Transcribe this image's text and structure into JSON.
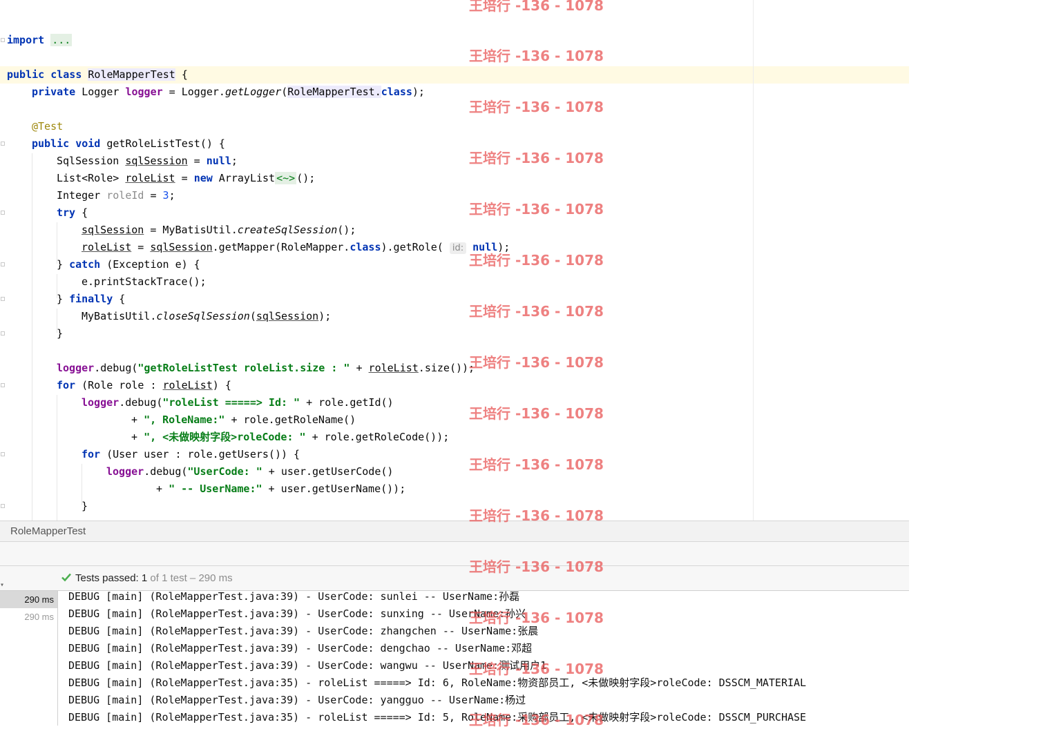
{
  "editor": {
    "lines": {
      "import_kw": "import",
      "import_fold": "...",
      "class_decl": {
        "kw": "public class",
        "name": "RoleMapperTest",
        "brace": " {"
      },
      "logger_decl": {
        "kw": "private",
        "type": " Logger ",
        "field": "logger",
        "eq": " = Logger.",
        "method": "getLogger",
        "open": "(",
        "ref": "RoleMapperTest",
        "dot": ".",
        "cls": "class",
        "close": ");"
      },
      "annotation": "@Test",
      "method_decl": {
        "kw": "public void",
        "rest": " getRoleListTest() {"
      },
      "l1": {
        "type": "SqlSession ",
        "var": "sqlSession",
        "eq": " = ",
        "nul": "null",
        "semi": ";"
      },
      "l2": {
        "type": "List<Role> ",
        "var": "roleList",
        "eq": " = ",
        "kw": "new",
        "cls": " ArrayList",
        "diamond": "<~>",
        "end": "();"
      },
      "l3": {
        "type": "Integer ",
        "var": "roleId",
        "eq": " = ",
        "num": "3",
        "semi": ";"
      },
      "l4": {
        "kw": "try",
        "brace": " {"
      },
      "l5": {
        "var": "sqlSession",
        "eq": " = MyBatisUtil.",
        "method": "createSqlSession",
        "end": "();"
      },
      "l6": {
        "var": "roleList",
        "eq": " = ",
        "var2": "sqlSession",
        "call": ".getMapper(RoleMapper.",
        "cls": "class",
        "call2": ").getRole( ",
        "hint": "id:",
        "nul": " null",
        "end": ");"
      },
      "l7": {
        "brace": "} ",
        "kw": "catch",
        "rest": " (Exception e) {"
      },
      "l8": "e.printStackTrace();",
      "l9": {
        "brace": "} ",
        "kw": "finally",
        "rest": " {"
      },
      "l10": {
        "pre": "MyBatisUtil.",
        "method": "closeSqlSession",
        "open": "(",
        "var": "sqlSession",
        "end": ");"
      },
      "l11": "}",
      "l12": {
        "field": "logger",
        "call": ".debug(",
        "str": "\"getRoleListTest roleList.size : \"",
        "plus": " + ",
        "var": "roleList",
        "end": ".size());"
      },
      "l13": {
        "kw": "for",
        "mid": " (Role role : ",
        "var": "roleList",
        "end": ") {"
      },
      "l14": {
        "field": "logger",
        "call": ".debug(",
        "str": "\"roleList =====> Id: \"",
        "end": " + role.getId()"
      },
      "l15": {
        "plus": "+ ",
        "str": "\", RoleName:\"",
        "end": " + role.getRoleName()"
      },
      "l16": {
        "plus": "+ ",
        "str": "\", <未做映射字段>roleCode: \"",
        "end": " + role.getRoleCode());"
      },
      "l17": {
        "kw": "for",
        "rest": " (User user : role.getUsers()) {"
      },
      "l18": {
        "field": "logger",
        "call": ".debug(",
        "str": "\"UserCode: \"",
        "end": " + user.getUserCode()"
      },
      "l19": {
        "plus": "+ ",
        "str": "\" -- UserName:\"",
        "end": " + user.getUserName());"
      },
      "l20": "}"
    }
  },
  "run_panel": {
    "tab_title": "RoleMapperTest",
    "status": {
      "prefix": "Tests passed: ",
      "count": "1",
      "rest": " of 1 test – 290 ms"
    },
    "tree": [
      {
        "time": "290 ms"
      },
      {
        "time": "290 ms"
      }
    ],
    "console_lines": [
      "DEBUG [main] (RoleMapperTest.java:39) - UserCode: sunlei -- UserName:孙磊",
      "DEBUG [main] (RoleMapperTest.java:39) - UserCode: sunxing -- UserName:孙兴",
      "DEBUG [main] (RoleMapperTest.java:39) - UserCode: zhangchen -- UserName:张晨",
      "DEBUG [main] (RoleMapperTest.java:39) - UserCode: dengchao -- UserName:邓超",
      "DEBUG [main] (RoleMapperTest.java:39) - UserCode: wangwu -- UserName:测试用户1",
      "DEBUG [main] (RoleMapperTest.java:35) - roleList =====> Id: 6, RoleName:物资部员工, <未做映射字段>roleCode: DSSCM_MATERIAL",
      "DEBUG [main] (RoleMapperTest.java:39) - UserCode: yangguo -- UserName:杨过",
      "DEBUG [main] (RoleMapperTest.java:35) - roleList =====> Id: 5, RoleName:采购部员工, <未做映射字段>roleCode: DSSCM_PURCHASE"
    ]
  },
  "watermark": "王培行 -136 - 1078",
  "colors": {
    "keyword": "#0033b3",
    "field": "#871094",
    "string": "#067d17",
    "annotation": "#9e880d",
    "watermark": "#e85050",
    "pass": "#4caf50"
  }
}
